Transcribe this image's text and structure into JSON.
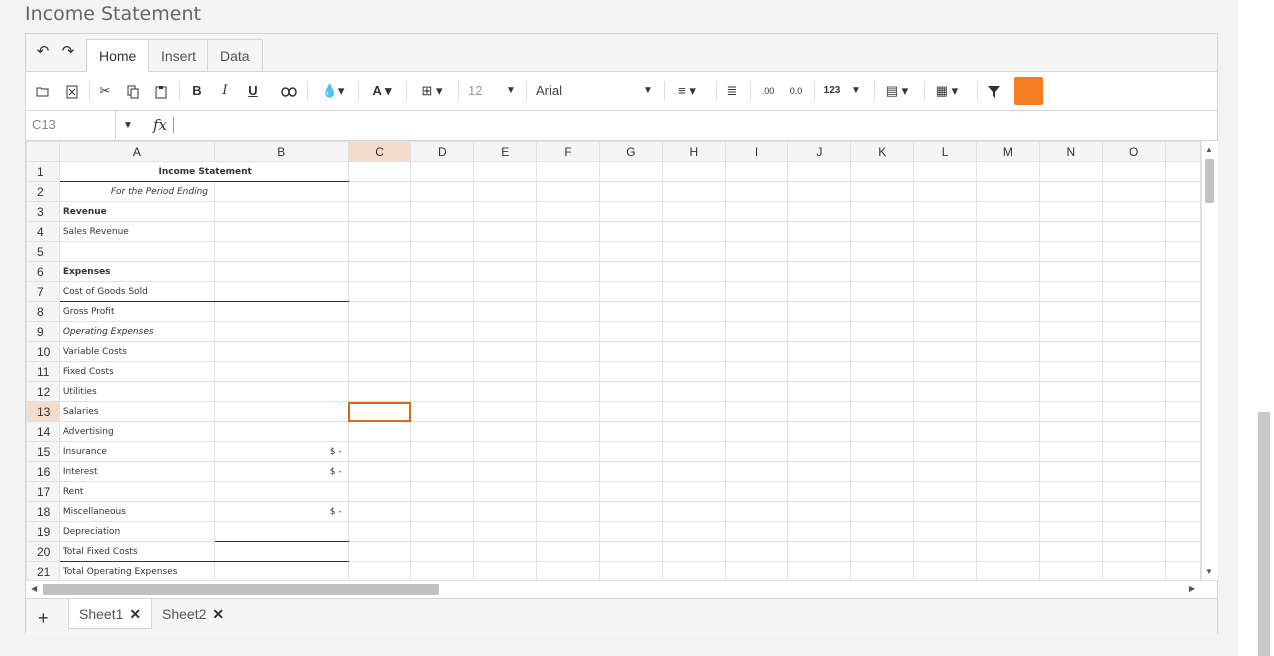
{
  "page": {
    "title": "Income Statement"
  },
  "ribbon": {
    "tabs": [
      {
        "label": "Home"
      },
      {
        "label": "Insert"
      },
      {
        "label": "Data"
      }
    ]
  },
  "toolbar": {
    "font_size": "12",
    "font_name": "Arial",
    "number_format_label": "123",
    "bold_label": "B",
    "italic_label": "I",
    "underline_label": "U",
    "text_color_label": "A",
    "decrease_decimal_label": ".00",
    "increase_decimal_label": "0.0"
  },
  "formula": {
    "name_box": "C13",
    "fx_label": "fx"
  },
  "grid": {
    "columns": [
      "A",
      "B",
      "C",
      "D",
      "E",
      "F",
      "G",
      "H",
      "I",
      "J",
      "K",
      "L",
      "M",
      "N",
      "O"
    ],
    "selected_column": "C",
    "selected_row": 13,
    "rows": [
      {
        "num": "1",
        "a": "Income Statement",
        "b": ""
      },
      {
        "num": "2",
        "a": "For the Period Ending",
        "b": ""
      },
      {
        "num": "3",
        "a": "Revenue",
        "b": ""
      },
      {
        "num": "4",
        "a": "Sales Revenue",
        "b": ""
      },
      {
        "num": "5",
        "a": "",
        "b": ""
      },
      {
        "num": "6",
        "a": "Expenses",
        "b": ""
      },
      {
        "num": "7",
        "a": "Cost of Goods Sold",
        "b": ""
      },
      {
        "num": "8",
        "a": "Gross Profit",
        "b": ""
      },
      {
        "num": "9",
        "a": "Operating Expenses",
        "b": ""
      },
      {
        "num": "10",
        "a": "Variable Costs",
        "b": ""
      },
      {
        "num": "11",
        "a": "Fixed Costs",
        "b": ""
      },
      {
        "num": "12",
        "a": "Utilities",
        "b": ""
      },
      {
        "num": "13",
        "a": "Salaries",
        "b": ""
      },
      {
        "num": "14",
        "a": "Advertising",
        "b": ""
      },
      {
        "num": "15",
        "a": "Insurance",
        "b": "$ -"
      },
      {
        "num": "16",
        "a": "Interest",
        "b": "$ -"
      },
      {
        "num": "17",
        "a": "Rent",
        "b": ""
      },
      {
        "num": "18",
        "a": "Miscellaneous",
        "b": "$ -"
      },
      {
        "num": "19",
        "a": "Depreciation",
        "b": ""
      },
      {
        "num": "20",
        "a": "Total Fixed Costs",
        "b": ""
      },
      {
        "num": "21",
        "a": "Total Operating Expenses",
        "b": ""
      }
    ]
  },
  "sheets": [
    {
      "label": "Sheet1"
    },
    {
      "label": "Sheet2"
    }
  ],
  "colors": {
    "accent": "#f57c1f",
    "selection_outline": "#d9681f",
    "header_selected": "#f4dccd"
  }
}
